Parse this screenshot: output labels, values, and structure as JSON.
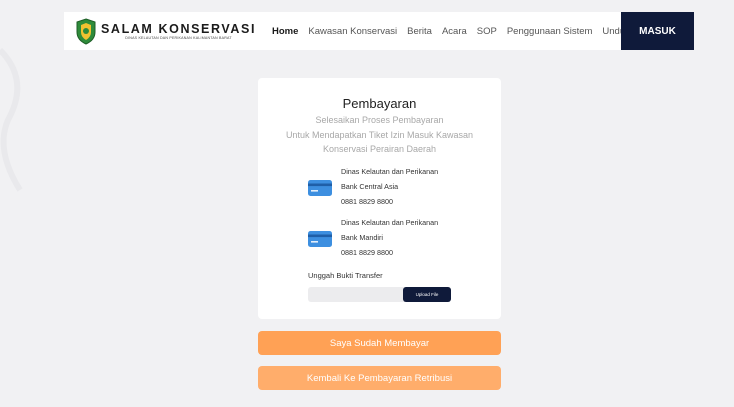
{
  "brand": {
    "title": "SALAM KONSERVASI",
    "subtitle": "DINAS KELAUTAN DAN PERIKANAN KALIMANTAN BARAT"
  },
  "nav": {
    "items": [
      {
        "label": "Home",
        "active": true
      },
      {
        "label": "Kawasan Konservasi",
        "active": false
      },
      {
        "label": "Berita",
        "active": false
      },
      {
        "label": "Acara",
        "active": false
      },
      {
        "label": "SOP",
        "active": false
      },
      {
        "label": "Penggunaan Sistem",
        "active": false
      },
      {
        "label": "Unduh",
        "active": false
      }
    ],
    "login_label": "MASUK"
  },
  "payment": {
    "title": "Pembayaran",
    "subtitle_lines": [
      "Selesaikan Proses Pembayaran",
      "Untuk Mendapatkan Tiket Izin Masuk Kawasan",
      "Konservasi Perairan Daerah"
    ],
    "banks": [
      {
        "account_name": "Dinas Kelautan dan Perikanan",
        "bank": "Bank Central Asia",
        "number": "0881 8829 8800",
        "icon": "credit-card-icon"
      },
      {
        "account_name": "Dinas Kelautan dan Perikanan",
        "bank": "Bank Mandiri",
        "number": "0881 8829 8800",
        "icon": "credit-card-icon"
      }
    ],
    "upload_label": "Unggah Bukti Transfer",
    "upload_button": "Upload File",
    "upload_value": ""
  },
  "actions": {
    "paid_label": "Saya Sudah Membayar",
    "back_label": "Kembali Ke Pembayaran Retribusi"
  },
  "colors": {
    "navy": "#0f1a3a",
    "orange": "#ffa155",
    "orange_light": "#ffad6b",
    "card_blue": "#3d8fe0",
    "background": "#f1f1f3"
  }
}
